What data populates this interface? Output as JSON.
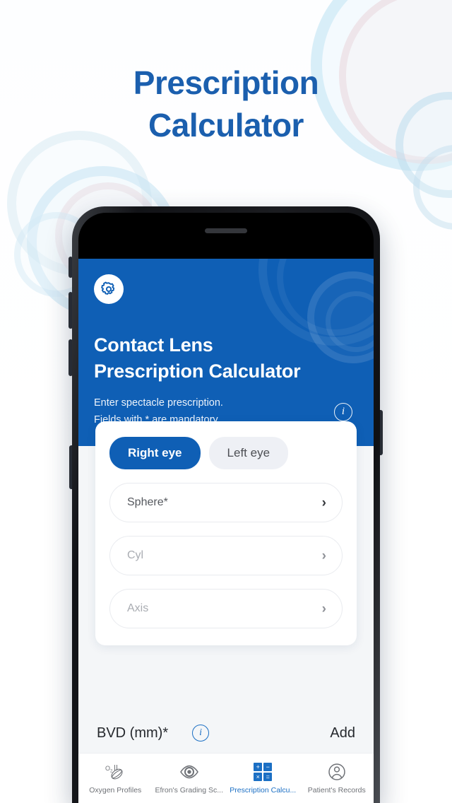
{
  "page": {
    "title_line1": "Prescription",
    "title_line2": "Calculator",
    "accent_color": "#1b5fae"
  },
  "app": {
    "header_color": "#0f5fb5",
    "gear_icon": "gear-icon",
    "title_line1": "Contact Lens",
    "title_line2": "Prescription Calculator",
    "subtitle_line1": "Enter spectacle prescription.",
    "subtitle_line2": "Fields with * are mandatory",
    "info_icon": "i"
  },
  "tabs": [
    {
      "label": "Right eye",
      "active": true
    },
    {
      "label": "Left eye",
      "active": false
    }
  ],
  "fields": [
    {
      "label": "Sphere*",
      "muted": false,
      "chevron": "›"
    },
    {
      "label": "Cyl",
      "muted": true,
      "chevron": "›"
    },
    {
      "label": "Axis",
      "muted": true,
      "chevron": "›"
    }
  ],
  "bvd": {
    "label": "BVD (mm)*",
    "info_icon": "i",
    "add_label": "Add"
  },
  "bottom_nav": [
    {
      "label": "Oxygen Profiles",
      "icon": "oxygen-profile-icon",
      "active": false
    },
    {
      "label": "Efron's Grading Sc...",
      "icon": "eye-icon",
      "active": false
    },
    {
      "label": "Prescription Calcu...",
      "icon": "calculator-icon",
      "active": true
    },
    {
      "label": "Patient's Records",
      "icon": "person-icon",
      "active": false
    }
  ],
  "calculator_icon_symbols": [
    "+",
    "−",
    "×",
    "="
  ]
}
